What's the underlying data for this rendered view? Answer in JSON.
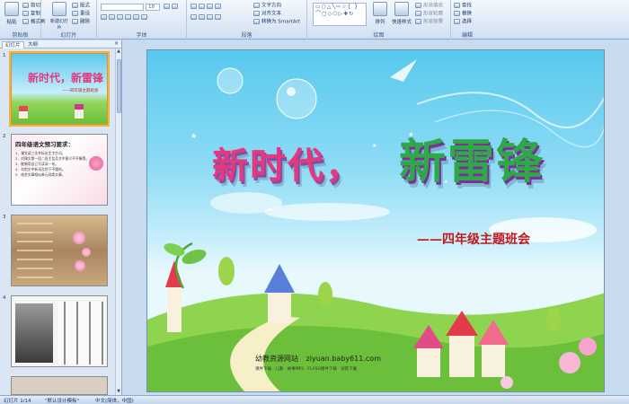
{
  "ribbon": {
    "clipboard": {
      "label": "剪贴板",
      "paste": "粘贴",
      "cut": "剪切",
      "copy": "复制",
      "format_painter": "格式刷"
    },
    "slides": {
      "label": "幻灯片",
      "new_slide": "新建幻灯片",
      "layout": "版式",
      "reset": "重设",
      "delete": "删除"
    },
    "font": {
      "label": "字体",
      "font_size": "18"
    },
    "paragraph": {
      "label": "段落",
      "text_direction": "文字方向",
      "align_text": "对齐文本",
      "smartart": "转换为 SmartArt"
    },
    "drawing": {
      "label": "绘图",
      "arrange": "排列",
      "quick_styles": "快速样式",
      "shape_fill": "形状填充",
      "shape_outline": "形状轮廓",
      "shape_effects": "形状效果"
    },
    "editing": {
      "label": "编辑",
      "find": "查找",
      "replace": "替换",
      "select": "选择"
    }
  },
  "panel": {
    "tab_slides": "幻灯片",
    "tab_outline": "大纲",
    "close": "×",
    "thumbs": [
      {
        "num": "1",
        "title": "新时代，新雷锋",
        "sub": "——四年级主题班会"
      },
      {
        "num": "2",
        "heading": "四年级语文预习要求：",
        "lines": [
          "1．课文读三次并标出生字生词。",
          "2．对课文第一段二段主旨及文中意义不平衡等。",
          "3．能够用自己写读读一句。",
          "4．勾划文中新词及划下不懂的。",
          "5．结合文章相似单元同类文章。"
        ]
      },
      {
        "num": "3"
      },
      {
        "num": "4"
      }
    ]
  },
  "slide": {
    "title_part1": "新时代，",
    "title_part2": "新雷锋",
    "subtitle": "——四年级主题班会",
    "site_name": "幼教资源网站",
    "site_url": "ziyuan.baby611.com",
    "footer_links": "课件下载 · 儿歌 · 故事MP3 · FLASH课件下载 · 试卷下载"
  },
  "status": {
    "slide_info": "幻灯片 1/14",
    "theme": "\"默认设计模板\"",
    "language": "中文(简体，中国)"
  },
  "colors": {
    "accent": "#3a5a86",
    "selection": "#f2b243",
    "sky": "#58c9ee",
    "grass": "#7cc843"
  }
}
